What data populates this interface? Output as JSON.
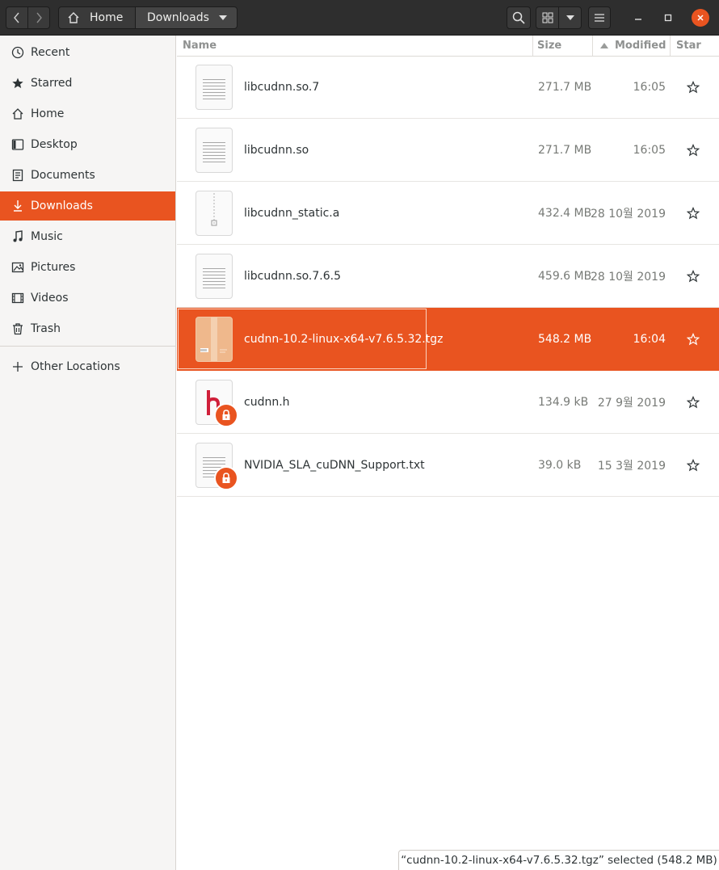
{
  "header": {
    "path": [
      "Home",
      "Downloads"
    ],
    "icons": {
      "back": "chevron-left-icon",
      "forward": "chevron-right-icon",
      "home": "home-icon",
      "search": "search-icon",
      "grid": "grid-view-icon",
      "menu": "hamburger-icon"
    }
  },
  "sidebar": {
    "items": [
      {
        "label": "Recent",
        "icon": "clock-icon"
      },
      {
        "label": "Starred",
        "icon": "star-icon"
      },
      {
        "label": "Home",
        "icon": "home-icon"
      },
      {
        "label": "Desktop",
        "icon": "desktop-icon"
      },
      {
        "label": "Documents",
        "icon": "document-icon"
      },
      {
        "label": "Downloads",
        "icon": "download-icon",
        "active": true
      },
      {
        "label": "Music",
        "icon": "music-icon"
      },
      {
        "label": "Pictures",
        "icon": "picture-icon"
      },
      {
        "label": "Videos",
        "icon": "video-icon"
      },
      {
        "label": "Trash",
        "icon": "trash-icon"
      }
    ],
    "other_locations": "Other Locations"
  },
  "columns": {
    "name": "Name",
    "size": "Size",
    "modified": "Modified",
    "star": "Star"
  },
  "files": [
    {
      "name": "libcudnn.so.7",
      "size": "271.7 MB",
      "modified": "16:05",
      "type": "text"
    },
    {
      "name": "libcudnn.so",
      "size": "271.7 MB",
      "modified": "16:05",
      "type": "text"
    },
    {
      "name": "libcudnn_static.a",
      "size": "432.4 MB",
      "modified": "28 10월 2019",
      "type": "archive"
    },
    {
      "name": "libcudnn.so.7.6.5",
      "size": "459.6 MB",
      "modified": "28 10월 2019",
      "type": "text"
    },
    {
      "name": "cudnn-10.2-linux-x64-v7.6.5.32.tgz",
      "size": "548.2 MB",
      "modified": "16:04",
      "type": "tgz",
      "selected": true
    },
    {
      "name": "cudnn.h",
      "size": "134.9 kB",
      "modified": "27  9월 2019",
      "type": "header",
      "locked": true
    },
    {
      "name": "NVIDIA_SLA_cuDNN_Support.txt",
      "size": "39.0 kB",
      "modified": "15  3월 2019",
      "type": "text",
      "locked": true
    }
  ],
  "status": "“cudnn-10.2-linux-x64-v7.6.5.32.tgz” selected  (548.2 MB)",
  "colors": {
    "accent": "#e95420",
    "header_bg": "#2e2e2e",
    "sidebar_bg": "#f6f5f4"
  }
}
